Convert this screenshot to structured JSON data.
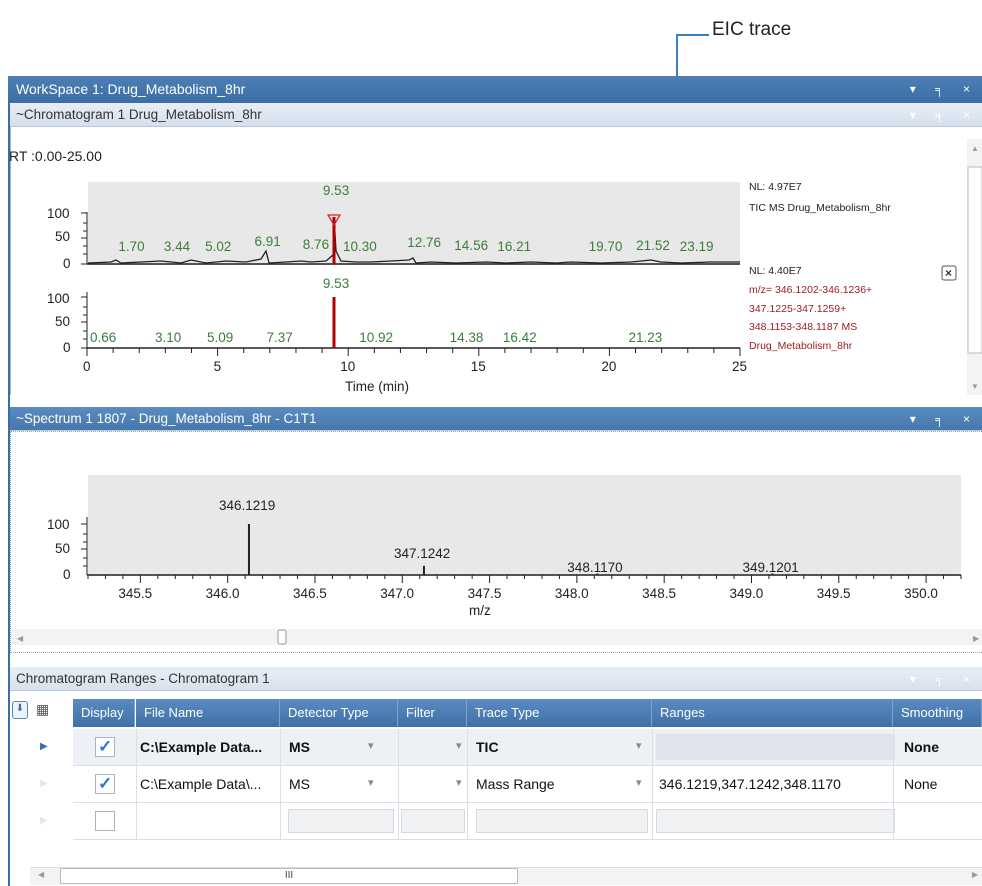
{
  "callout": {
    "label": "EIC trace"
  },
  "workspace": {
    "title": "WorkSpace 1: Drug_Metabolism_8hr",
    "controls": "▾ ╕ ×"
  },
  "chromatogram": {
    "title": "~Chromatogram  1  Drug_Metabolism_8hr",
    "rt_label": "RT :0.00-25.00",
    "tic_info": {
      "nl": "NL: 4.97E7",
      "desc": "TIC  MS  Drug_Metabolism_8hr"
    },
    "eic_info": {
      "nl": "NL: 4.40E7",
      "l1": "m/z= 346.1202-346.1236+",
      "l2": "347.1225-347.1259+",
      "l3": "348.1153-348.1187 MS",
      "l4": "Drug_Metabolism_8hr"
    },
    "xlabel": "Time (min)"
  },
  "chart_data": [
    {
      "type": "line",
      "title": "TIC",
      "x_range": [
        0,
        25
      ],
      "y_ticks": [
        "100",
        "50",
        "0"
      ],
      "peak_labels": [
        {
          "x": 1.7,
          "label": "1.70"
        },
        {
          "x": 3.44,
          "label": "3.44"
        },
        {
          "x": 5.02,
          "label": "5.02"
        },
        {
          "x": 6.91,
          "label": "6.91"
        },
        {
          "x": 8.76,
          "label": "8.76"
        },
        {
          "x": 9.53,
          "label": "9.53"
        },
        {
          "x": 10.3,
          "label": "10.30"
        },
        {
          "x": 12.76,
          "label": "12.76"
        },
        {
          "x": 14.56,
          "label": "14.56"
        },
        {
          "x": 16.21,
          "label": "16.21"
        },
        {
          "x": 19.7,
          "label": "19.70"
        },
        {
          "x": 21.52,
          "label": "21.52"
        },
        {
          "x": 23.19,
          "label": "23.19"
        }
      ]
    },
    {
      "type": "line",
      "title": "EIC",
      "x_range": [
        0,
        25
      ],
      "x_ticks": [
        "0",
        "5",
        "10",
        "15",
        "20",
        "25"
      ],
      "xlabel": "Time (min)",
      "y_ticks": [
        "100",
        "50",
        "0"
      ],
      "peak_labels": [
        {
          "x": 0.66,
          "label": "0.66"
        },
        {
          "x": 3.1,
          "label": "3.10"
        },
        {
          "x": 5.09,
          "label": "5.09"
        },
        {
          "x": 7.37,
          "label": "7.37"
        },
        {
          "x": 9.53,
          "label": "9.53"
        },
        {
          "x": 10.92,
          "label": "10.92"
        },
        {
          "x": 14.38,
          "label": "14.38"
        },
        {
          "x": 16.42,
          "label": "16.42"
        },
        {
          "x": 21.23,
          "label": "21.23"
        }
      ]
    },
    {
      "type": "bar",
      "title": "Spectrum",
      "x_range": [
        345.2,
        350.2
      ],
      "x_ticks": [
        "345.5",
        "346.0",
        "346.5",
        "347.0",
        "347.5",
        "348.0",
        "348.5",
        "349.0",
        "349.5",
        "350.0"
      ],
      "xlabel": "m/z",
      "y_ticks": [
        "100",
        "50",
        "0"
      ],
      "peaks": [
        {
          "mz": 346.1219,
          "intensity": 100,
          "label": "346.1219"
        },
        {
          "mz": 347.1242,
          "intensity": 18,
          "label": "347.1242"
        },
        {
          "mz": 348.117,
          "intensity": 2,
          "label": "348.1170"
        },
        {
          "mz": 349.1201,
          "intensity": 0.5,
          "label": "349.1201"
        }
      ]
    }
  ],
  "spectrum": {
    "title": "~Spectrum  1  1807 - Drug_Metabolism_8hr - C1T1",
    "xlabel": "m/z"
  },
  "ranges": {
    "title": "Chromatogram Ranges  - Chromatogram 1",
    "headers": [
      "Display",
      "File Name",
      "Detector Type",
      "Filter",
      "Trace Type",
      "Ranges",
      "Smoothing"
    ],
    "rows": [
      {
        "checked": true,
        "file": "C:\\Example Data...",
        "detector": "MS",
        "trace": "TIC",
        "ranges": "",
        "smoothing": "None",
        "bold": true
      },
      {
        "checked": true,
        "file": "C:\\Example Data\\...",
        "detector": "MS",
        "trace": "Mass Range",
        "ranges": "346.1219,347.1242,348.1170",
        "smoothing": "None",
        "bold": false
      },
      {
        "checked": false,
        "file": "",
        "detector": "",
        "trace": "",
        "ranges": "",
        "smoothing": "",
        "bold": false
      }
    ],
    "hscroll_mark": "III"
  },
  "colors": {
    "title_blue": "#3b6ea5",
    "peak_red": "#b00000",
    "label_green": "#3a7d3a",
    "eic_info_red": "#9b1b1b"
  }
}
